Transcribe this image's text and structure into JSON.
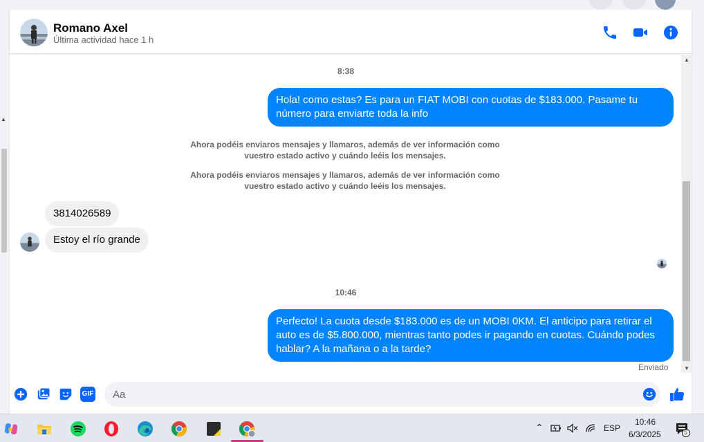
{
  "contact": {
    "name": "Romano Axel",
    "status": "Última actividad hace 1 h"
  },
  "header_icons": [
    "phone-icon",
    "video-icon",
    "info-icon"
  ],
  "messages": {
    "time1": "8:38",
    "out1": "Hola! como estas? Es para un FIAT MOBI con cuotas de $183.000. Pasame tu número para enviarte toda la info",
    "system1": "Ahora podéis enviaros mensajes y llamaros, además de ver información como vuestro estado activo y cuándo leéis los mensajes.",
    "system2": "Ahora podéis enviaros mensajes y llamaros, además de ver información como vuestro estado activo y cuándo leéis los mensajes.",
    "in1": "3814026589",
    "in2": "Estoy el río grande",
    "time2": "10:46",
    "out2": "Perfecto! La cuota desde $183.000 es de un MOBI 0KM. El anticipo para retirar el auto es de $5.800.000, mientras tanto podes ir pagando en cuotas. Cuándo podes hablar? A la mañana o a la tarde?",
    "sent_status": "Enviado"
  },
  "composer": {
    "placeholder": "Aa",
    "icons": [
      "plus-icon",
      "image-icon",
      "sticker-icon",
      "gif-icon",
      "emoji-icon",
      "like-icon"
    ],
    "gif_label": "GIF"
  },
  "taskbar": {
    "apps": [
      "copilot-icon",
      "file-explorer-icon",
      "spotify-icon",
      "opera-icon",
      "edge-icon",
      "chrome-icon",
      "sticky-notes-icon",
      "chrome-profile-icon"
    ],
    "language": "ESP",
    "time": "10:46",
    "date": "6/3/2025",
    "notification_count": "5"
  },
  "colors": {
    "accent": "#0084ff",
    "icon_blue": "#0866ff"
  }
}
